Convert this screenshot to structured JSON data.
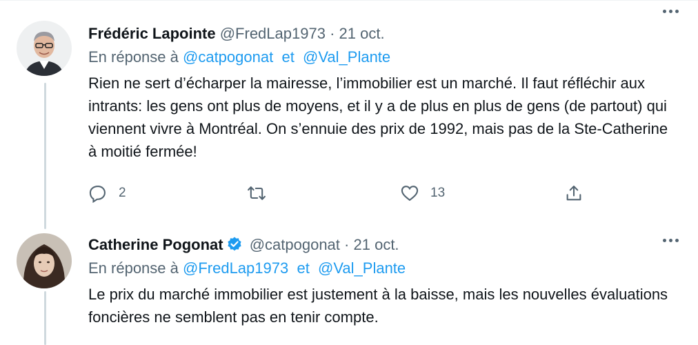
{
  "tweet1": {
    "name": "Frédéric Lapointe",
    "handle": "@FredLap1973",
    "separator": "·",
    "date": "21 oct.",
    "reply_prefix": "En réponse à",
    "mention1": "@catpogonat",
    "conj": "et",
    "mention2": "@Val_Plante",
    "text": "Rien ne sert d’écharper la mairesse, l’immobilier est un marché. Il faut réfléchir aux intrants: les gens ont plus de moyens, et il y a de plus en plus de gens (de partout) qui viennent vivre à Montréal. On s’ennuie des prix de 1992, mais pas de la Ste-Catherine à moitié fermée!",
    "replies": "2",
    "likes": "13"
  },
  "tweet2": {
    "name": "Catherine Pogonat",
    "handle": "@catpogonat",
    "separator": "·",
    "date": "21 oct.",
    "reply_prefix": "En réponse à",
    "mention1": "@FredLap1973",
    "conj": "et",
    "mention2": "@Val_Plante",
    "text": "Le prix du marché immobilier est justement à la baisse, mais les nouvelles évaluations foncières ne semblent pas en tenir compte."
  },
  "colors": {
    "accent": "#1d9bf0",
    "muted": "#536471",
    "text": "#0f1419",
    "thread_line": "#cfd9de"
  },
  "icons": [
    "more-icon",
    "reply-icon",
    "retweet-icon",
    "like-icon",
    "share-icon",
    "verified-badge-icon"
  ]
}
